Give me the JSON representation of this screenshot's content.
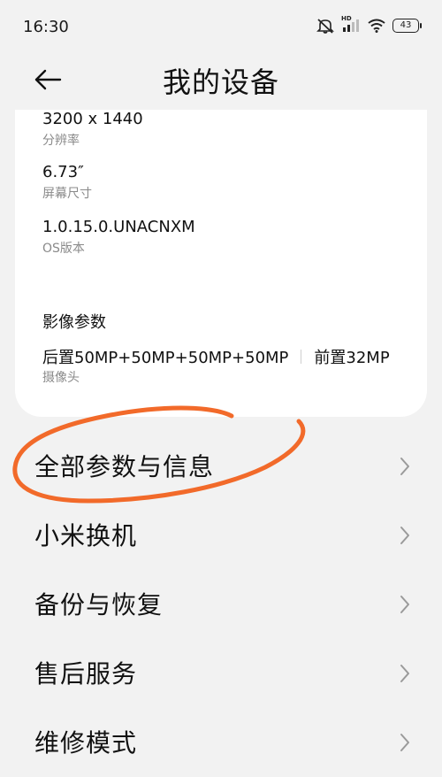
{
  "status_bar": {
    "time": "16:30",
    "hd_label": "HD",
    "battery_level": "43",
    "icons": [
      "mute-icon",
      "signal-icon",
      "wifi-icon",
      "battery-icon"
    ]
  },
  "header": {
    "title": "我的设备",
    "back_icon": "arrow-left-icon"
  },
  "specs": [
    {
      "value": "3200 x 1440",
      "label": "分辨率"
    },
    {
      "value": "6.73″",
      "label": "屏幕尺寸"
    },
    {
      "value": "1.0.15.0.UNACNXM",
      "label": "OS版本"
    }
  ],
  "imaging": {
    "title": "影像参数",
    "rear": "后置50MP+50MP+50MP+50MP",
    "front": "前置32MP",
    "label": "摄像头"
  },
  "menu": [
    {
      "label": "全部参数与信息"
    },
    {
      "label": "小米换机"
    },
    {
      "label": "备份与恢复"
    },
    {
      "label": "售后服务"
    },
    {
      "label": "维修模式"
    }
  ],
  "colors": {
    "background": "#f2f2f2",
    "card": "#ffffff",
    "annotation": "#f26a2a",
    "secondary_text": "#8a8a8a"
  }
}
